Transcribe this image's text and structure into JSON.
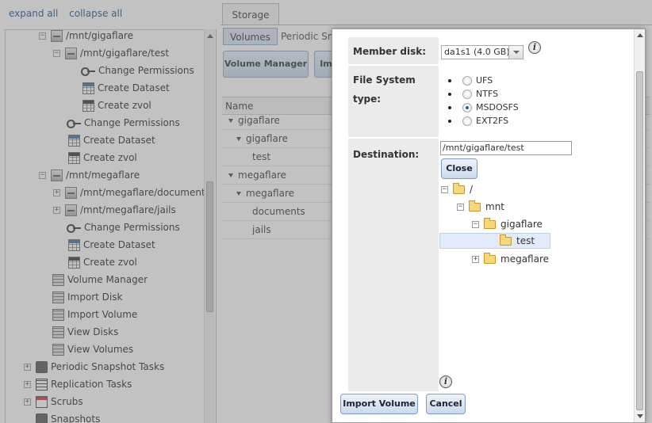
{
  "nav": {
    "expand_all": "expand all",
    "collapse_all": "collapse all",
    "items": [
      {
        "label": "/mnt/gigaflare",
        "icon": "disk-icon"
      },
      {
        "label": "/mnt/gigaflare/test",
        "icon": "disk-icon"
      },
      {
        "label": "Change Permissions",
        "icon": "key-icon"
      },
      {
        "label": "Create Dataset",
        "icon": "dataset-icon"
      },
      {
        "label": "Create zvol",
        "icon": "zvol-icon"
      },
      {
        "label": "Change Permissions",
        "icon": "key-icon"
      },
      {
        "label": "Create Dataset",
        "icon": "dataset-icon"
      },
      {
        "label": "Create zvol",
        "icon": "zvol-icon"
      },
      {
        "label": "/mnt/megaflare",
        "icon": "disk-icon"
      },
      {
        "label": "/mnt/megaflare/document",
        "icon": "disk-icon"
      },
      {
        "label": "/mnt/megaflare/jails",
        "icon": "disk-icon"
      },
      {
        "label": "Change Permissions",
        "icon": "key-icon"
      },
      {
        "label": "Create Dataset",
        "icon": "dataset-icon"
      },
      {
        "label": "Create zvol",
        "icon": "zvol-icon"
      },
      {
        "label": "Volume Manager",
        "icon": "volume-manager-icon"
      },
      {
        "label": "Import Disk",
        "icon": "import-disk-icon"
      },
      {
        "label": "Import Volume",
        "icon": "import-volume-icon"
      },
      {
        "label": "View Disks",
        "icon": "view-disks-icon"
      },
      {
        "label": "View Volumes",
        "icon": "view-volumes-icon"
      },
      {
        "label": "Periodic Snapshot Tasks",
        "icon": "snapshot-tasks-icon"
      },
      {
        "label": "Replication Tasks",
        "icon": "replication-icon"
      },
      {
        "label": "Scrubs",
        "icon": "calendar-icon"
      },
      {
        "label": "Snapshots",
        "icon": "camera-icon"
      }
    ]
  },
  "main": {
    "tab": "Storage",
    "subtabs": [
      "Volumes",
      "Periodic Sn"
    ],
    "buttons": [
      "Volume Manager",
      "Im"
    ],
    "grid_header": "Name",
    "rows": [
      "gigaflare",
      "gigaflare",
      "test",
      "megaflare",
      "megaflare",
      "documents",
      "jails"
    ]
  },
  "modal": {
    "member_disk_label": "Member disk:",
    "member_disk_value": "da1s1 (4.0 GB)",
    "fs_label_line1": "File System",
    "fs_label_line2": "type:",
    "fs_options": [
      "UFS",
      "NTFS",
      "MSDOSFS",
      "EXT2FS"
    ],
    "fs_selected": "MSDOSFS",
    "destination_label": "Destination:",
    "destination_value": "/mnt/gigaflare/test",
    "close_button": "Close",
    "tree": [
      "/",
      "mnt",
      "gigaflare",
      "test",
      "megaflare"
    ],
    "import_button": "Import Volume",
    "cancel_button": "Cancel",
    "info_glyph": "i"
  }
}
